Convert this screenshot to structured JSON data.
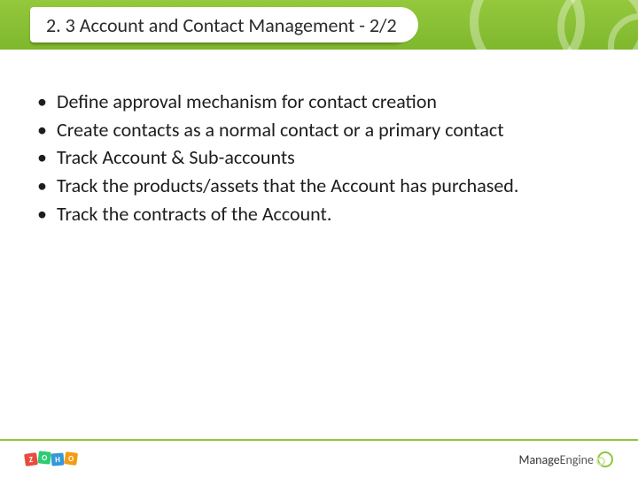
{
  "header": {
    "title": "2. 3 Account and Contact Management - 2/2"
  },
  "bullets": [
    "Define approval mechanism for contact creation",
    "Create contacts as a normal contact or a primary contact",
    "Track Account & Sub-accounts",
    "Track the products/assets that the Account has purchased.",
    "Track the contracts of the Account."
  ],
  "footer": {
    "left_logo_letters": [
      "Z",
      "O",
      "H",
      "O"
    ],
    "right_logo_text_bold": "Manage",
    "right_logo_text_light": "Engine"
  }
}
